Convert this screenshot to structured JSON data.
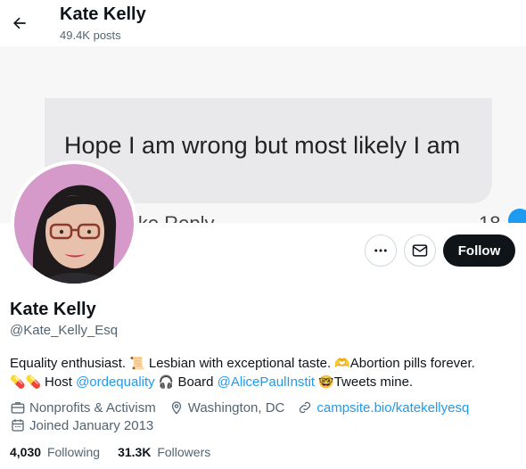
{
  "header": {
    "name": "Kate Kelly",
    "posts": "49.4K posts"
  },
  "banner": {
    "quote": "Hope I am wrong but most likely I am",
    "partial_text": "ike    Reply",
    "partial_count": "18"
  },
  "actions": {
    "follow_label": "Follow"
  },
  "profile": {
    "display_name": "Kate Kelly",
    "handle": "@Kate_Kelly_Esq",
    "bio": {
      "part1": "Equality enthusiast. ",
      "part2": " Lesbian with exceptional taste. ",
      "part3": "Abortion pills forever.",
      "part4": " Host ",
      "link1": "@ordequality",
      "part5": " Board ",
      "link2": "@AlicePaulInstit",
      "part6": "Tweets mine."
    },
    "category": "Nonprofits & Activism",
    "location": "Washington, DC",
    "website": "campsite.bio/katekellyesq",
    "joined": "Joined January 2013"
  },
  "stats": {
    "following_count": "4,030",
    "following_label": "Following",
    "followers_count": "31.3K",
    "followers_label": "Followers"
  },
  "colors": {
    "accent": "#1d9bf0",
    "text": "#0f1419",
    "secondary": "#536471"
  }
}
